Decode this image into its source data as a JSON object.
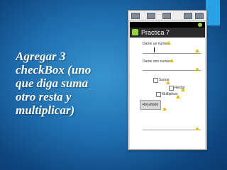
{
  "slide": {
    "lines": [
      "Agregar 3",
      "checkBox (uno",
      "que diga suma",
      "otro resta y",
      "multiplicar)"
    ]
  },
  "app": {
    "title": "Practica 7",
    "field1_label": "Dame un numero",
    "field2_label": "Dame otro numero",
    "checkbox_sumar": "Sumar",
    "checkbox_restar": "Restar",
    "checkbox_multiplicar": "Multiplicar",
    "button_label": "Resultado"
  },
  "colors": {
    "accent": "#2aa3e6",
    "warning": "#e6b800",
    "android_green": "#9bd13a"
  }
}
